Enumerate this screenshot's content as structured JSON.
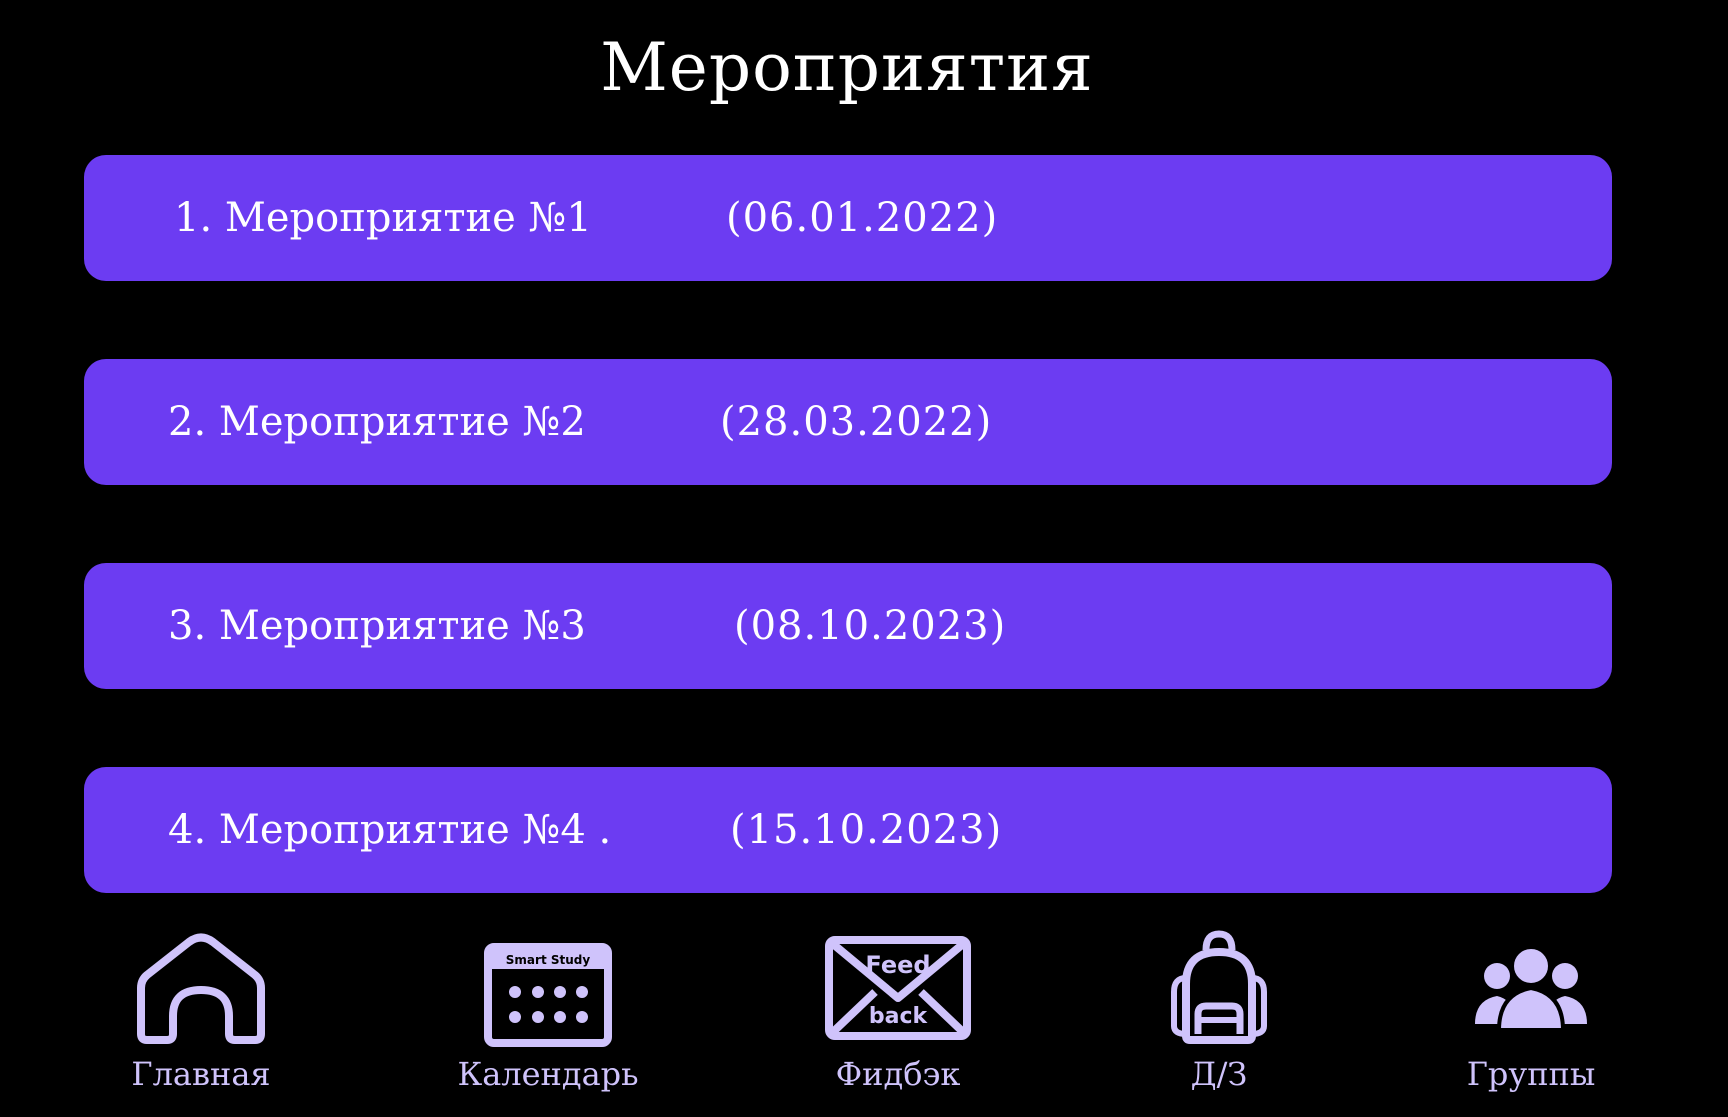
{
  "page": {
    "title": "Мероприятия"
  },
  "colors": {
    "background": "#000000",
    "card": "#6c3cf2",
    "nav_accent": "#cfc3fb",
    "text": "#ffffff"
  },
  "events": [
    {
      "label": "1. Мероприятие №1",
      "date": "(06.01.2022)"
    },
    {
      "label": "2. Мероприятие №2",
      "date": "(28.03.2022)"
    },
    {
      "label": "3. Мероприятие №3",
      "date": "(08.10.2023)"
    },
    {
      "label": "4. Мероприятие №4 .",
      "date": "(15.10.2023)"
    }
  ],
  "nav": {
    "items": [
      {
        "label": "Главная",
        "icon": "home-icon"
      },
      {
        "label": "Календарь",
        "icon": "calendar-icon",
        "icon_text": "Smart Study"
      },
      {
        "label": "Фидбэк",
        "icon": "feedback-envelope-icon",
        "icon_text_top": "Feed",
        "icon_text_bottom": "back"
      },
      {
        "label": "Д/З",
        "icon": "backpack-icon"
      },
      {
        "label": "Группы",
        "icon": "users-group-icon"
      }
    ]
  }
}
